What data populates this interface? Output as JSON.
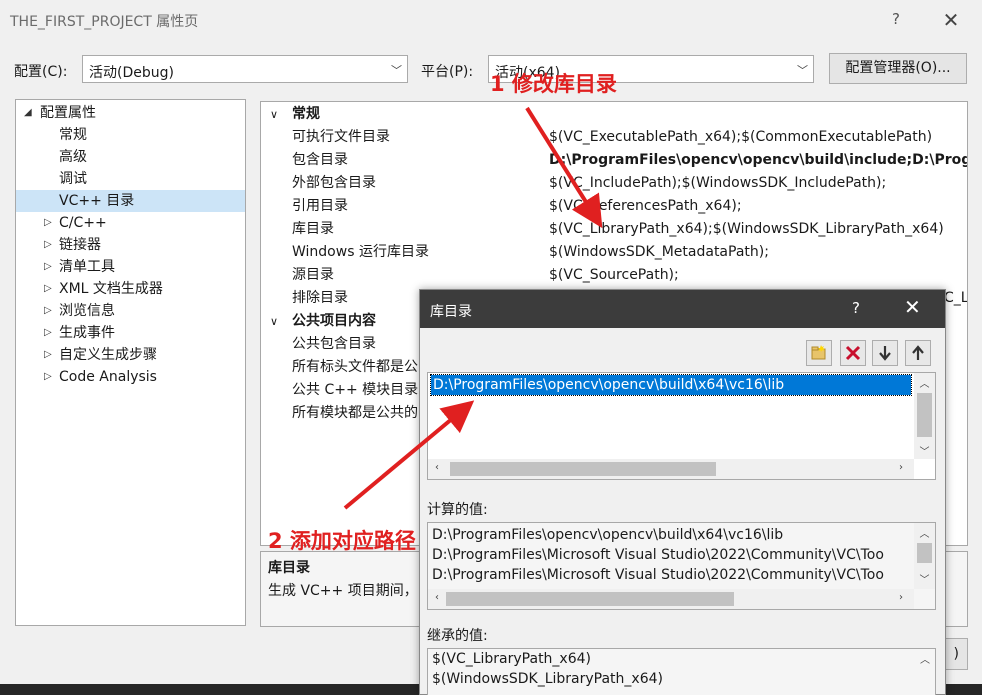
{
  "window": {
    "title": "THE_FIRST_PROJECT 属性页",
    "help": "?",
    "close": "✕"
  },
  "config_row": {
    "config_label": "配置(C):",
    "config_value": "活动(Debug)",
    "platform_label": "平台(P):",
    "platform_value": "活动(x64)",
    "manager_button": "配置管理器(O)..."
  },
  "tree": {
    "root": "配置属性",
    "items": [
      {
        "label": "常规",
        "expandable": false
      },
      {
        "label": "高级",
        "expandable": false
      },
      {
        "label": "调试",
        "expandable": false
      },
      {
        "label": "VC++ 目录",
        "expandable": false,
        "selected": true
      },
      {
        "label": "C/C++",
        "expandable": true
      },
      {
        "label": "链接器",
        "expandable": true
      },
      {
        "label": "清单工具",
        "expandable": true
      },
      {
        "label": "XML 文档生成器",
        "expandable": true
      },
      {
        "label": "浏览信息",
        "expandable": true
      },
      {
        "label": "生成事件",
        "expandable": true
      },
      {
        "label": "自定义生成步骤",
        "expandable": true
      },
      {
        "label": "Code Analysis",
        "expandable": true
      }
    ]
  },
  "grid": {
    "categories": [
      {
        "name": "常规",
        "rows": [
          {
            "name": "可执行文件目录",
            "value": "$(VC_ExecutablePath_x64);$(CommonExecutablePath)",
            "bold": false
          },
          {
            "name": "包含目录",
            "value": "D:\\ProgramFiles\\opencv\\opencv\\build\\include;D:\\Progr",
            "bold": true
          },
          {
            "name": "外部包含目录",
            "value": "$(VC_IncludePath);$(WindowsSDK_IncludePath);",
            "bold": false
          },
          {
            "name": "引用目录",
            "value": "$(VC_ReferencesPath_x64);",
            "bold": false
          },
          {
            "name": "库目录",
            "value": "$(VC_LibraryPath_x64);$(WindowsSDK_LibraryPath_x64)",
            "bold": false
          },
          {
            "name": "Windows 运行库目录",
            "value": "$(WindowsSDK_MetadataPath);",
            "bold": false
          },
          {
            "name": "源目录",
            "value": "$(VC_SourcePath);",
            "bold": false
          },
          {
            "name": "排除目录",
            "value": "C_L",
            "bold": false
          }
        ]
      },
      {
        "name": "公共项目内容",
        "rows": [
          {
            "name": "公共包含目录",
            "value": "",
            "bold": false
          },
          {
            "name": "所有标头文件都是公",
            "value": "",
            "bold": false
          },
          {
            "name": "公共 C++ 模块目录",
            "value": "",
            "bold": false
          },
          {
            "name": "所有模块都是公共的",
            "value": "",
            "bold": false
          }
        ]
      }
    ]
  },
  "description": {
    "title": "库目录",
    "text": "生成 VC++ 项目期间，"
  },
  "ok_fragment": ")",
  "dialog": {
    "title": "库目录",
    "help": "?",
    "close": "✕",
    "toolbar_icons": [
      "new-folder-icon",
      "delete-icon",
      "move-down-icon",
      "move-up-icon"
    ],
    "list_items": [
      "D:\\ProgramFiles\\opencv\\opencv\\build\\x64\\vc16\\lib"
    ],
    "computed_label": "计算的值:",
    "computed_values": [
      "D:\\ProgramFiles\\opencv\\opencv\\build\\x64\\vc16\\lib",
      "D:\\ProgramFiles\\Microsoft Visual Studio\\2022\\Community\\VC\\Too",
      "D:\\ProgramFiles\\Microsoft Visual Studio\\2022\\Community\\VC\\Too"
    ],
    "inherited_label": "继承的值:",
    "inherited_values": [
      "$(VC_LibraryPath_x64)",
      "$(WindowsSDK_LibraryPath_x64)"
    ]
  },
  "annotations": {
    "step1": "1 修改库目录",
    "step2": "2 添加对应路径",
    "color": "#e02020"
  },
  "colors": {
    "selection": "#0078d7",
    "tree_selection": "#cce4f7",
    "dialog_titlebar": "#3c3c3c"
  }
}
